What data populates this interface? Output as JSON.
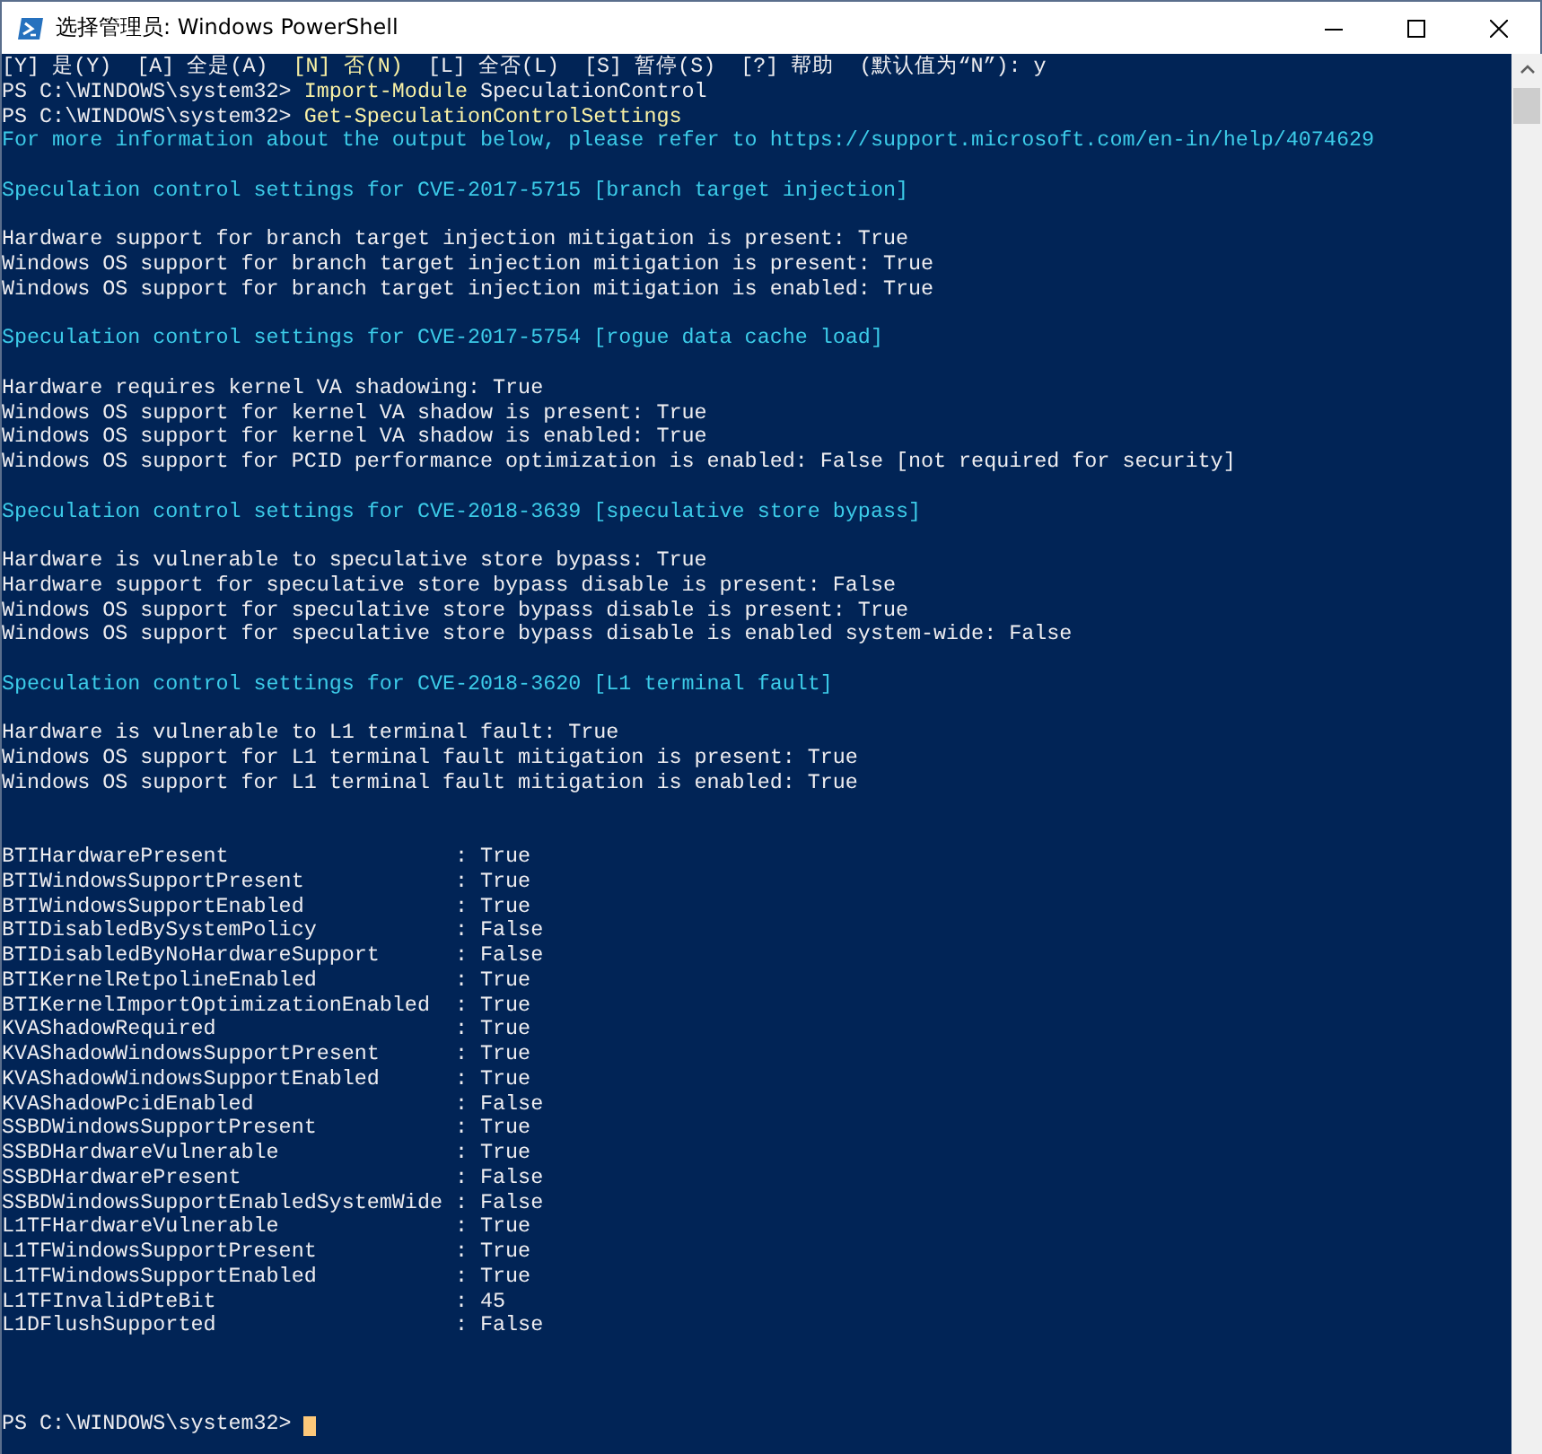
{
  "window": {
    "title": "选择管理员: Windows PowerShell"
  },
  "console": {
    "lines": [
      {
        "kind": "choice",
        "options": [
          {
            "text": "[Y] 是(Y)",
            "selected": false
          },
          {
            "text": "[A] 全是(A)",
            "selected": false
          },
          {
            "text": "[N] 否(N)",
            "selected": true
          },
          {
            "text": "[L] 全否(L)",
            "selected": false
          },
          {
            "text": "[S] 暂停(S)",
            "selected": false
          },
          {
            "text": "[?] 帮助",
            "selected": false
          }
        ],
        "text": "(默认值为“N”): y"
      },
      {
        "kind": "prompt",
        "prompt": "PS C:\\WINDOWS\\system32>",
        "command": "Import-Module",
        "argument": "SpeculationControl"
      },
      {
        "kind": "prompt",
        "prompt": "PS C:\\WINDOWS\\system32>",
        "command": "Get-SpeculationControlSettings"
      },
      {
        "kind": "info",
        "text": "For more information about the output below, please refer to https://support.microsoft.com/en-in/help/4074629"
      },
      {
        "kind": "blank"
      },
      {
        "kind": "info",
        "text": "Speculation control settings for CVE-2017-5715 [branch target injection]"
      },
      {
        "kind": "blank"
      },
      {
        "kind": "output",
        "text": "Hardware support for branch target injection mitigation is present: True"
      },
      {
        "kind": "output",
        "text": "Windows OS support for branch target injection mitigation is present: True"
      },
      {
        "kind": "output",
        "text": "Windows OS support for branch target injection mitigation is enabled: True"
      },
      {
        "kind": "blank"
      },
      {
        "kind": "info",
        "text": "Speculation control settings for CVE-2017-5754 [rogue data cache load]"
      },
      {
        "kind": "blank"
      },
      {
        "kind": "output",
        "text": "Hardware requires kernel VA shadowing: True"
      },
      {
        "kind": "output",
        "text": "Windows OS support for kernel VA shadow is present: True"
      },
      {
        "kind": "output",
        "text": "Windows OS support for kernel VA shadow is enabled: True"
      },
      {
        "kind": "output",
        "text": "Windows OS support for PCID performance optimization is enabled: False [not required for security]"
      },
      {
        "kind": "blank"
      },
      {
        "kind": "info",
        "text": "Speculation control settings for CVE-2018-3639 [speculative store bypass]"
      },
      {
        "kind": "blank"
      },
      {
        "kind": "output",
        "text": "Hardware is vulnerable to speculative store bypass: True"
      },
      {
        "kind": "output",
        "text": "Hardware support for speculative store bypass disable is present: False"
      },
      {
        "kind": "output",
        "text": "Windows OS support for speculative store bypass disable is present: True"
      },
      {
        "kind": "output",
        "text": "Windows OS support for speculative store bypass disable is enabled system-wide: False"
      },
      {
        "kind": "blank"
      },
      {
        "kind": "info",
        "text": "Speculation control settings for CVE-2018-3620 [L1 terminal fault]"
      },
      {
        "kind": "blank"
      },
      {
        "kind": "output",
        "text": "Hardware is vulnerable to L1 terminal fault: True"
      },
      {
        "kind": "output",
        "text": "Windows OS support for L1 terminal fault mitigation is present: True"
      },
      {
        "kind": "output",
        "text": "Windows OS support for L1 terminal fault mitigation is enabled: True"
      },
      {
        "kind": "blank"
      },
      {
        "kind": "blank"
      },
      {
        "kind": "output",
        "text": "BTIHardwarePresent                  : True"
      },
      {
        "kind": "output",
        "text": "BTIWindowsSupportPresent            : True"
      },
      {
        "kind": "output",
        "text": "BTIWindowsSupportEnabled            : True"
      },
      {
        "kind": "output",
        "text": "BTIDisabledBySystemPolicy           : False"
      },
      {
        "kind": "output",
        "text": "BTIDisabledByNoHardwareSupport      : False"
      },
      {
        "kind": "output",
        "text": "BTIKernelRetpolineEnabled           : True"
      },
      {
        "kind": "output",
        "text": "BTIKernelImportOptimizationEnabled  : True"
      },
      {
        "kind": "output",
        "text": "KVAShadowRequired                   : True"
      },
      {
        "kind": "output",
        "text": "KVAShadowWindowsSupportPresent      : True"
      },
      {
        "kind": "output",
        "text": "KVAShadowWindowsSupportEnabled      : True"
      },
      {
        "kind": "output",
        "text": "KVAShadowPcidEnabled                : False"
      },
      {
        "kind": "output",
        "text": "SSBDWindowsSupportPresent           : True"
      },
      {
        "kind": "output",
        "text": "SSBDHardwareVulnerable              : True"
      },
      {
        "kind": "output",
        "text": "SSBDHardwarePresent                 : False"
      },
      {
        "kind": "output",
        "text": "SSBDWindowsSupportEnabledSystemWide : False"
      },
      {
        "kind": "output",
        "text": "L1TFHardwareVulnerable              : True"
      },
      {
        "kind": "output",
        "text": "L1TFWindowsSupportPresent           : True"
      },
      {
        "kind": "output",
        "text": "L1TFWindowsSupportEnabled           : True"
      },
      {
        "kind": "output",
        "text": "L1TFInvalidPteBit                   : 45"
      },
      {
        "kind": "output",
        "text": "L1DFlushSupported                   : False"
      },
      {
        "kind": "blank"
      },
      {
        "kind": "blank"
      },
      {
        "kind": "blank"
      },
      {
        "kind": "prompt",
        "prompt": "PS C:\\WINDOWS\\system32>",
        "cursor": true
      }
    ]
  }
}
